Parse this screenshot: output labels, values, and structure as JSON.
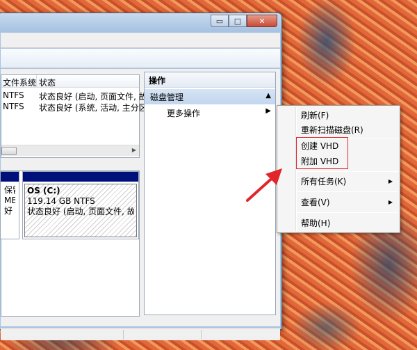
{
  "window": {
    "caption": {
      "minimize_glyph": "▭",
      "maximize_glyph": "□",
      "close_glyph": "✕"
    }
  },
  "volume_list": {
    "headers": [
      "文件系统",
      "状态"
    ],
    "rows": [
      {
        "fs": "NTFS",
        "status": "状态良好 (启动, 页面文件, 故"
      },
      {
        "fs": "NTFS",
        "status": "状态良好 (系统, 活动, 主分区"
      }
    ]
  },
  "disk_map": {
    "partition_left": {
      "line1": "保留",
      "line2": "MB N",
      "line3": "好"
    },
    "partition_os": {
      "name": "OS  (C:)",
      "size": "119.14 GB NTFS",
      "status": "状态良好 (启动, 页面文件, 故"
    }
  },
  "actions": {
    "title": "操作",
    "section": "磁盘管理",
    "more": "更多操作",
    "section_glyph": "▲",
    "more_glyph": "▶"
  },
  "context_menu": {
    "items": [
      {
        "label": "刷新(F)"
      },
      {
        "label": "重新扫描磁盘(R)"
      },
      {
        "label": "创建 VHD"
      },
      {
        "label": "附加 VHD"
      },
      {
        "label": "所有任务(K)",
        "submenu": true
      },
      {
        "label": "查看(V)",
        "submenu": true
      },
      {
        "label": "帮助(H)"
      }
    ],
    "submenu_glyph": "▶"
  },
  "colors": {
    "highlight": "#e0262a",
    "partition_bar": "#00107b"
  }
}
